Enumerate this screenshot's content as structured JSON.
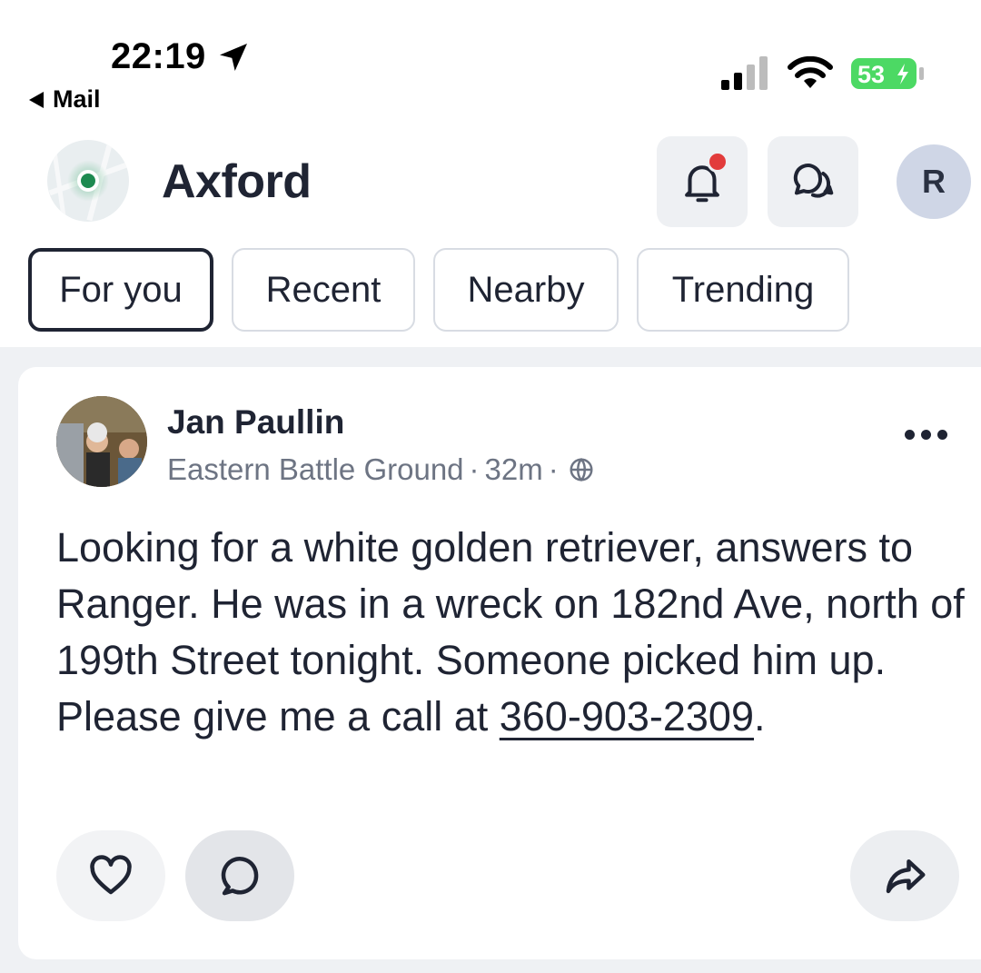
{
  "status_bar": {
    "time": "22:19",
    "back_label": "Mail",
    "battery": "53"
  },
  "header": {
    "title": "Axford",
    "profile_initial": "R"
  },
  "tabs": [
    {
      "label": "For you",
      "active": true
    },
    {
      "label": "Recent",
      "active": false
    },
    {
      "label": "Nearby",
      "active": false
    },
    {
      "label": "Trending",
      "active": false
    }
  ],
  "post": {
    "author": "Jan Paullin",
    "location": "Eastern Battle Ground",
    "time_ago": "32m",
    "separator": "·",
    "body_text": "Looking for a white golden retriever, answers to Ranger. He was in a wreck on 182nd Ave, north of 199th Street tonight. Someone picked him up. Please give me a call at ",
    "phone": "360-903-2309",
    "body_end": "."
  },
  "icons": {
    "location": "location-arrow-icon",
    "notifications": "bell-icon",
    "messages": "chat-bubbles-icon",
    "more": "more-dots-icon",
    "globe": "globe-icon",
    "like": "heart-icon",
    "comment": "comment-icon",
    "share": "share-icon"
  },
  "colors": {
    "accent": "#1f2433",
    "notification_dot": "#e23b3b",
    "location_dot": "#1d8a50",
    "battery_green": "#4cd964",
    "meta_gray": "#6d7483"
  }
}
